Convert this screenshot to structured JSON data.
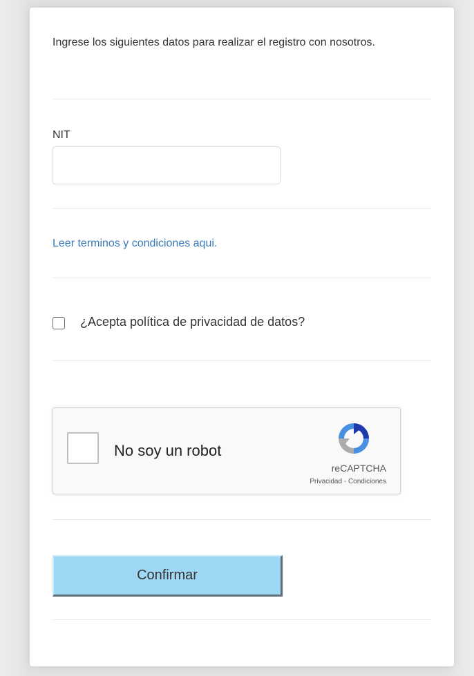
{
  "form": {
    "intro_text": "Ingrese los siguientes datos para realizar el registro con nosotros.",
    "nit": {
      "label": "NIT",
      "value": "",
      "placeholder": ""
    },
    "terms_link": "Leer terminos y condiciones aqui.",
    "privacy": {
      "label": "¿Acepta política de privacidad de datos?",
      "checked": false
    },
    "recaptcha": {
      "label": "No soy un robot",
      "brand": "reCAPTCHA",
      "privacy_link": "Privacidad",
      "separator": " - ",
      "terms_link": "Condiciones",
      "logo_icon": "recaptcha-logo-icon"
    },
    "confirm_button": "Confirmar"
  },
  "colors": {
    "link": "#3a7ab8",
    "button_bg": "#9fd8f5",
    "card_bg": "#ffffff",
    "page_bg": "#e2e2e2"
  }
}
